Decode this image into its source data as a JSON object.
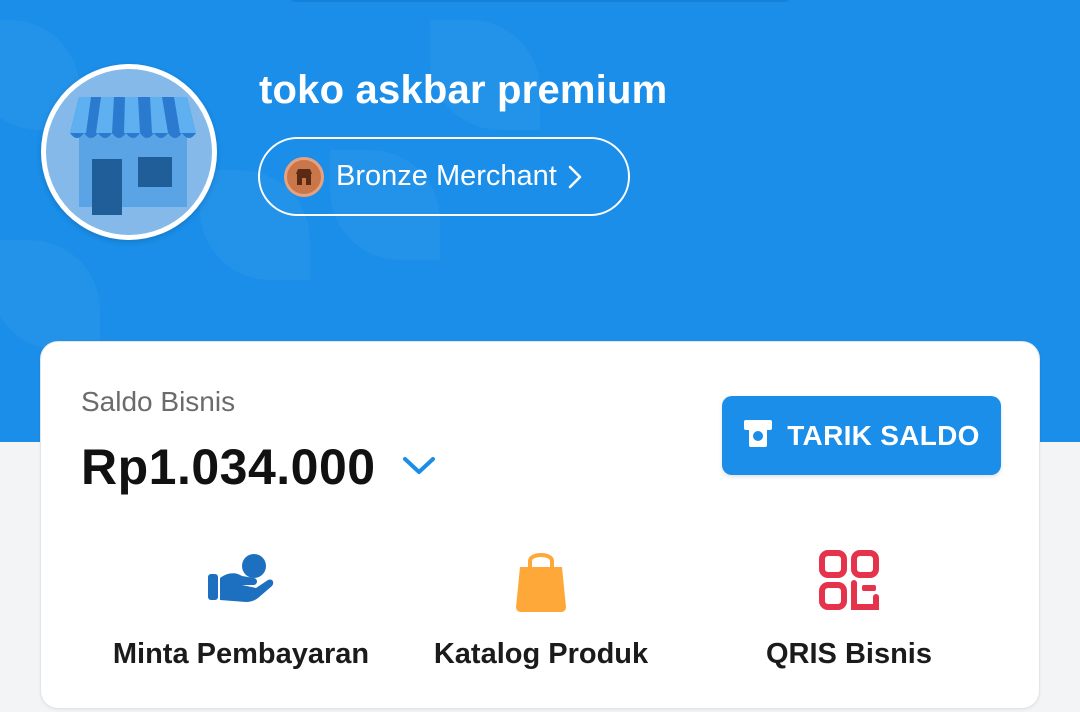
{
  "store": {
    "name": "toko askbar premium",
    "tier_label": "Bronze Merchant"
  },
  "balance": {
    "label": "Saldo Bisnis",
    "amount": "Rp1.034.000",
    "withdraw_label": "TARIK SALDO"
  },
  "actions": [
    {
      "label": "Minta Pembayaran",
      "icon": "hand-coin-icon"
    },
    {
      "label": "Katalog Produk",
      "icon": "shopping-bag-icon"
    },
    {
      "label": "QRIS Bisnis",
      "icon": "qris-icon"
    }
  ],
  "colors": {
    "primary": "#1a8ee9",
    "bag": "#ffa83a",
    "qris": "#e5334b",
    "bronze": "#c9764b"
  }
}
